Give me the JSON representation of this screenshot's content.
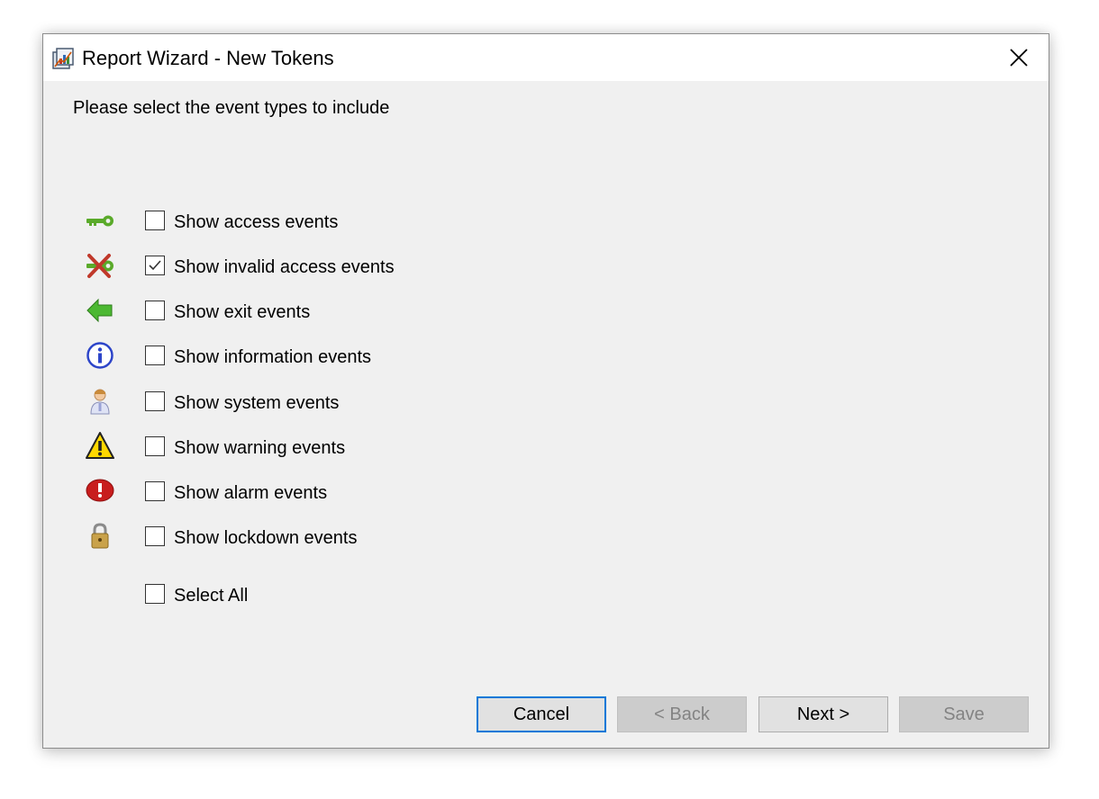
{
  "window": {
    "title": "Report Wizard - New Tokens"
  },
  "prompt": "Please select the event types to include",
  "events": [
    {
      "label": "Show access events",
      "icon": "key-icon",
      "checked": false
    },
    {
      "label": "Show invalid access events",
      "icon": "invalid-access-icon",
      "checked": true
    },
    {
      "label": "Show exit events",
      "icon": "exit-arrow-icon",
      "checked": false
    },
    {
      "label": "Show information events",
      "icon": "info-icon",
      "checked": false
    },
    {
      "label": "Show system events",
      "icon": "system-user-icon",
      "checked": false
    },
    {
      "label": "Show warning events",
      "icon": "warning-icon",
      "checked": false
    },
    {
      "label": "Show alarm events",
      "icon": "alarm-icon",
      "checked": false
    },
    {
      "label": "Show lockdown events",
      "icon": "padlock-icon",
      "checked": false
    }
  ],
  "select_all": {
    "label": "Select All",
    "checked": false
  },
  "buttons": {
    "cancel": "Cancel",
    "back": "< Back",
    "next": "Next >",
    "save": "Save"
  },
  "colors": {
    "accent": "#0078d7",
    "dialog_bg": "#f0f0f0",
    "disabled_text": "#838383"
  }
}
